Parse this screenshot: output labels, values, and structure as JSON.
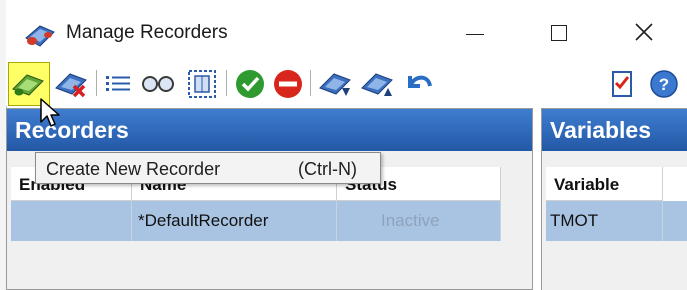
{
  "window": {
    "title": "Manage Recorders",
    "icon": "recorder-app-icon"
  },
  "toolbar": {
    "buttons": [
      {
        "icon": "create-recorder-icon",
        "active": true
      },
      {
        "icon": "delete-recorder-icon"
      },
      {
        "icon": "list-icon"
      },
      {
        "icon": "view-glasses-icon"
      },
      {
        "icon": "fit-columns-icon"
      },
      {
        "icon": "enable-check-icon"
      },
      {
        "icon": "disable-stop-icon"
      },
      {
        "icon": "import-recorder-icon"
      },
      {
        "icon": "export-recorder-icon"
      },
      {
        "icon": "undo-icon"
      },
      {
        "icon": "checklist-icon"
      },
      {
        "icon": "help-icon"
      }
    ]
  },
  "tooltip": {
    "label": "Create New Recorder",
    "shortcut": "(Ctrl-N)"
  },
  "recorders_panel": {
    "title": "Recorders",
    "columns": [
      "Enabled",
      "Name",
      "Status"
    ],
    "rows": [
      {
        "enabled": "",
        "name": "*DefaultRecorder",
        "status": "Inactive"
      }
    ]
  },
  "variables_panel": {
    "title": "Variables",
    "columns": [
      "Variable"
    ],
    "rows": [
      {
        "variable": "TMOT"
      }
    ]
  },
  "colors": {
    "panel_header": "#2d66b8",
    "selected_row": "#a9c4e2",
    "active_toolbar_button": "#ffff66"
  }
}
